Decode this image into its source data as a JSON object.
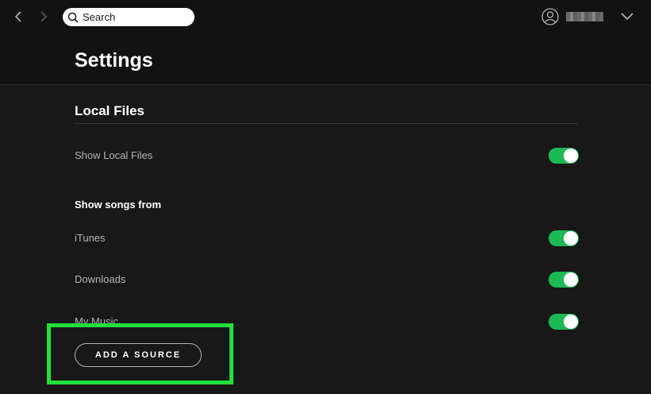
{
  "header": {
    "search": {
      "placeholder": "Search"
    },
    "user": {
      "name": ""
    }
  },
  "settings": {
    "title": "Settings",
    "section": {
      "title": "Local Files",
      "show_local_files": {
        "label": "Show Local Files",
        "enabled": true
      },
      "sources_heading": "Show songs from",
      "sources": [
        {
          "label": "iTunes",
          "enabled": true
        },
        {
          "label": "Downloads",
          "enabled": true
        },
        {
          "label": "My Music",
          "enabled": true
        }
      ],
      "add_source_label": "ADD A SOURCE"
    }
  },
  "colors": {
    "background": "#181818",
    "header_background": "#121212",
    "accent_green": "#1db954",
    "annotation_green": "#22e03b",
    "text_primary": "#ffffff",
    "text_secondary": "#b3b3b3"
  },
  "icons": {
    "back": "chevron-left-icon",
    "forward": "chevron-right-icon",
    "search": "search-icon",
    "user": "user-icon",
    "menu": "chevron-down-icon"
  }
}
